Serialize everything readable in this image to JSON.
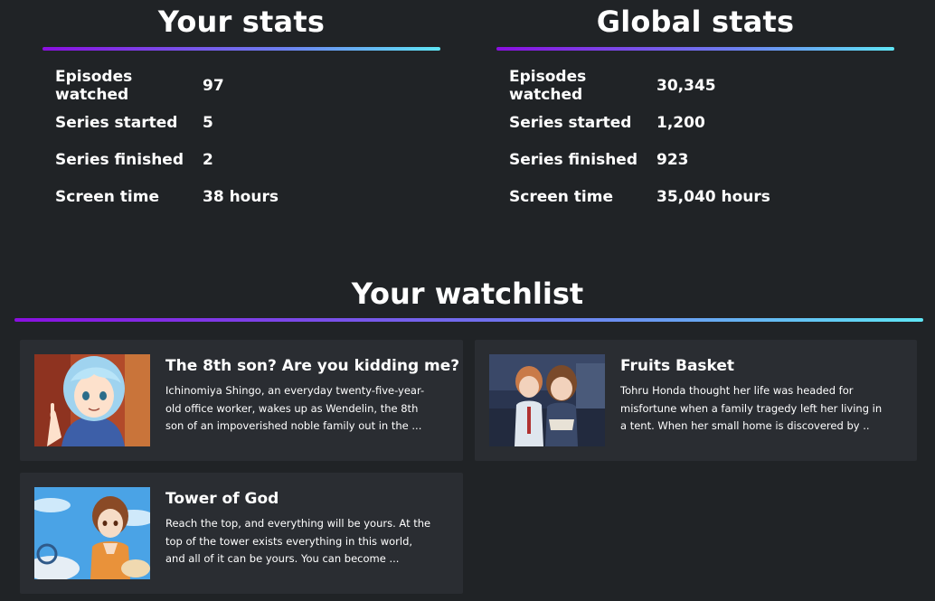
{
  "your_stats": {
    "title": "Your stats",
    "rows": [
      {
        "label": "Episodes watched",
        "value": "97"
      },
      {
        "label": "Series started",
        "value": "5"
      },
      {
        "label": "Series finished",
        "value": "2"
      },
      {
        "label": "Screen time",
        "value": "38 hours"
      }
    ]
  },
  "global_stats": {
    "title": "Global stats",
    "rows": [
      {
        "label": "Episodes watched",
        "value": "30,345"
      },
      {
        "label": "Series started",
        "value": "1,200"
      },
      {
        "label": "Series finished",
        "value": "923"
      },
      {
        "label": "Screen time",
        "value": "35,040 hours"
      }
    ]
  },
  "watchlist": {
    "title": "Your watchlist",
    "items": [
      {
        "title": "The 8th son? Are you kidding me?",
        "description": "Ichinomiya Shingo, an everyday twenty-five-year-old office worker, wakes up as Wendelin, the 8th son of an impoverished noble family out in the ..."
      },
      {
        "title": "Fruits Basket",
        "description": "Tohru Honda thought her life was headed for misfortune when a family tragedy left her living in a tent. When her small home is discovered by .."
      },
      {
        "title": "Tower of God",
        "description": "Reach the top, and everything will be yours. At the top of the tower exists everything in this world, and all of it can be yours. You can become ..."
      }
    ]
  },
  "colors": {
    "background": "#202326",
    "card": "#2a2d32",
    "gradient_start": "#8a0fe0",
    "gradient_end": "#5fe6f5"
  }
}
